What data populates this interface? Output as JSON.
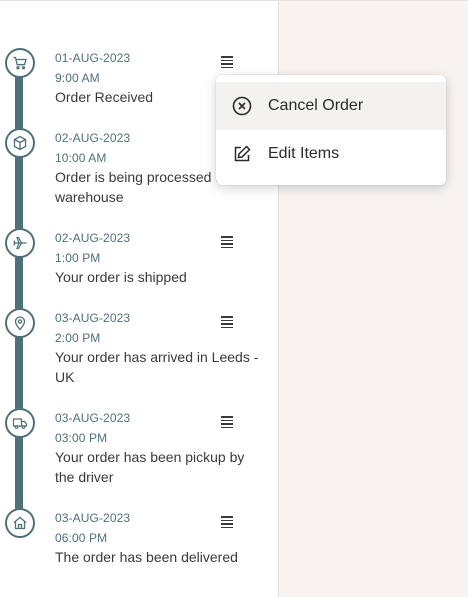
{
  "colors": {
    "timeline": "#4f7078",
    "right_panel": "#f7f4f2",
    "popup_highlight": "#f3f2f0"
  },
  "timeline": {
    "items": [
      {
        "date": "01-AUG-2023",
        "time": "9:00 AM",
        "description": "Order Received",
        "icon": "cart-icon"
      },
      {
        "date": "02-AUG-2023",
        "time": "10:00 AM",
        "description": "Order is being processed in warehouse",
        "icon": "box-icon"
      },
      {
        "date": "02-AUG-2023",
        "time": "1:00 PM",
        "description": "Your order is shipped",
        "icon": "airplane-icon"
      },
      {
        "date": "03-AUG-2023",
        "time": "2:00 PM",
        "description": "Your order has arrived in Leeds - UK",
        "icon": "location-pin-icon"
      },
      {
        "date": "03-AUG-2023",
        "time": "03:00 PM",
        "description": "Your order has been pickup by the driver",
        "icon": "truck-icon"
      },
      {
        "date": "03-AUG-2023",
        "time": "06:00 PM",
        "description": "The order has been delivered",
        "icon": "home-icon"
      }
    ]
  },
  "context_menu": {
    "items": [
      {
        "label": "Cancel Order",
        "icon": "cancel-circle-icon"
      },
      {
        "label": "Edit Items",
        "icon": "edit-icon"
      }
    ]
  }
}
